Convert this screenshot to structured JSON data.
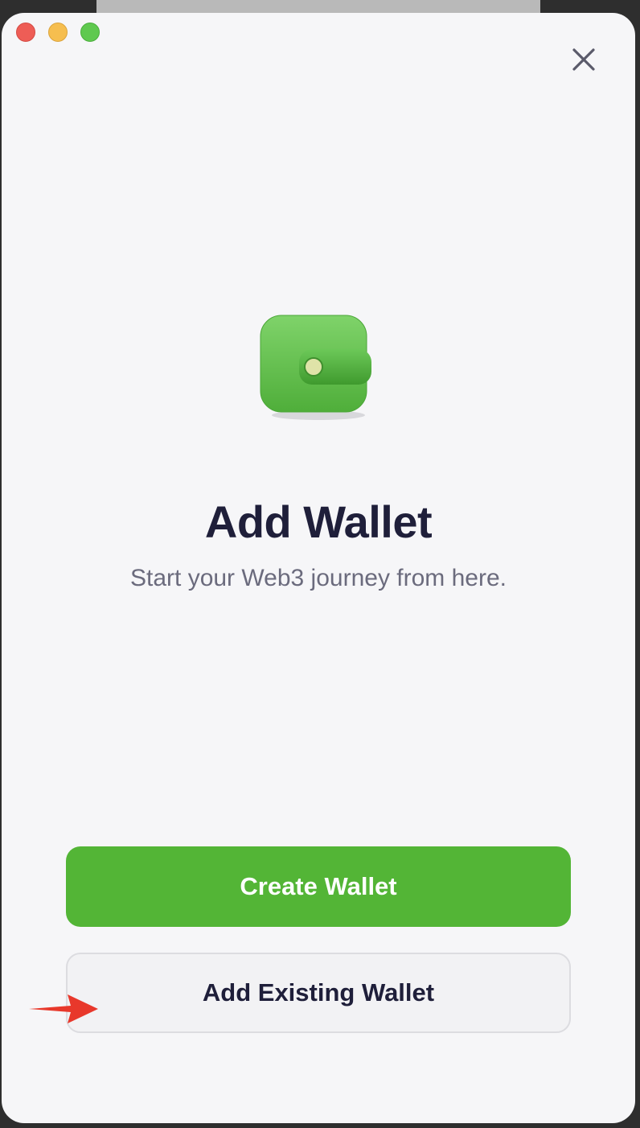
{
  "window": {
    "traffic_lights": [
      "close",
      "minimize",
      "zoom"
    ],
    "close_icon": "close-icon"
  },
  "hero": {
    "icon": "wallet-icon",
    "title": "Add Wallet",
    "subtitle": "Start your Web3 journey from here."
  },
  "actions": {
    "create_label": "Create Wallet",
    "add_existing_label": "Add Existing Wallet"
  },
  "annotation": {
    "arrow_icon": "red-arrow-icon"
  },
  "colors": {
    "primary": "#53b536",
    "title": "#1f1f3a",
    "subtitle": "#6b6b7d",
    "background": "#f6f6f8",
    "arrow": "#e8382b"
  }
}
